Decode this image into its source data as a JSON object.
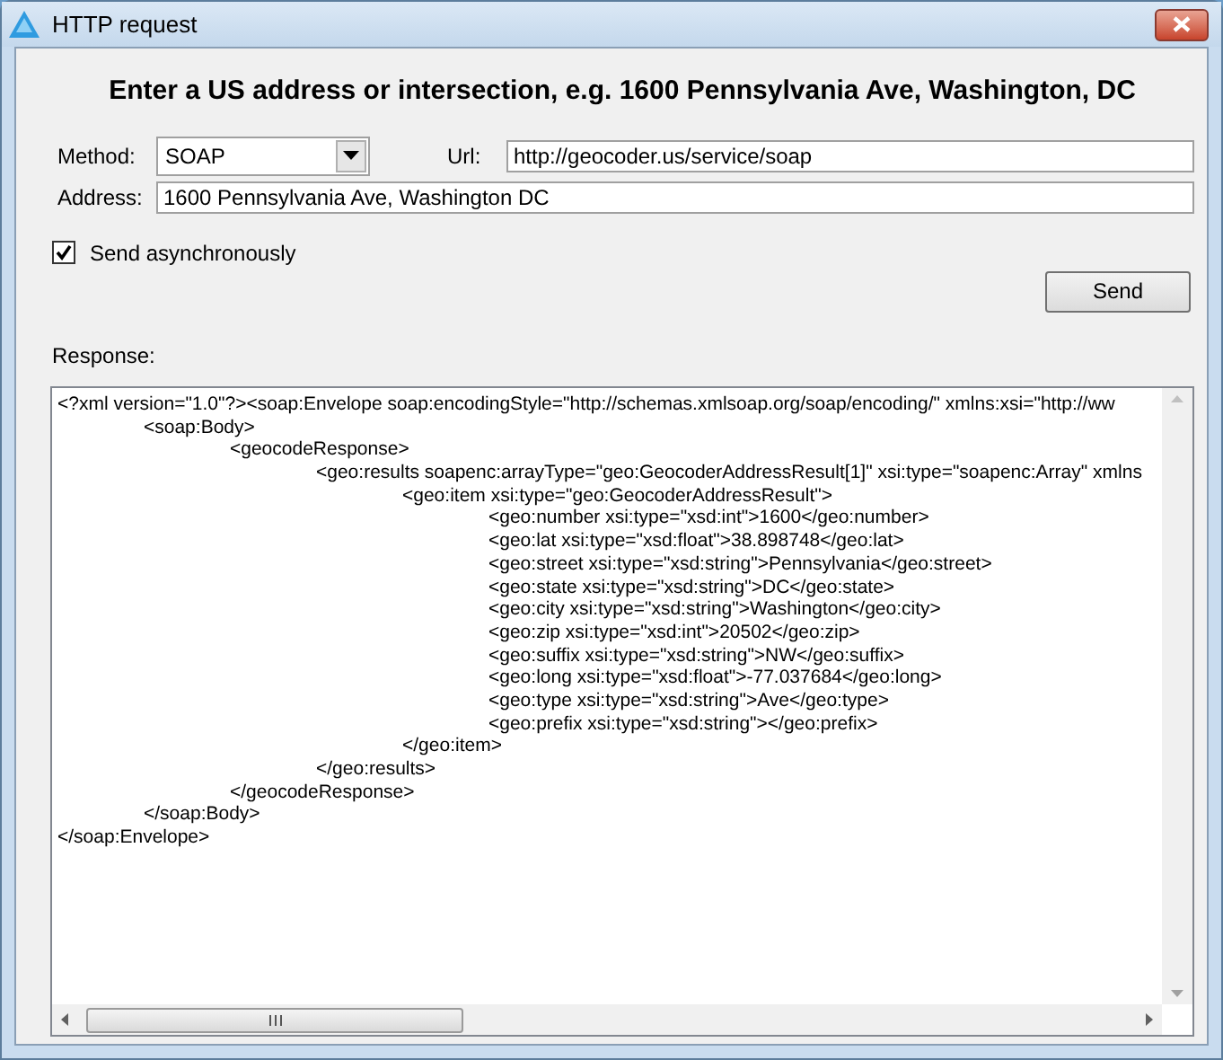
{
  "window": {
    "title": "HTTP request"
  },
  "heading": "Enter a US address or intersection, e.g. 1600 Pennsylvania Ave, Washington, DC",
  "method": {
    "label": "Method:",
    "value": "SOAP"
  },
  "url": {
    "label": "Url:",
    "value": "http://geocoder.us/service/soap"
  },
  "address": {
    "label": "Address:",
    "value": "1600 Pennsylvania Ave, Washington DC"
  },
  "async": {
    "label": "Send asynchronously",
    "checked": true
  },
  "send_button": "Send",
  "response": {
    "label": "Response:",
    "lines": [
      {
        "line": "<?xml version=\"1.0\"?><soap:Envelope soap:encodingStyle=\"http://schemas.xmlsoap.org/soap/encoding/\" xmlns:xsi=\"http://ww",
        "end": "</soap:Envelope>",
        "children": [
          {
            "line": "<soap:Body>",
            "end": "</soap:Body>",
            "children": [
              {
                "line": "<geocodeResponse>",
                "end": "</geocodeResponse>",
                "children": [
                  {
                    "line": "<geo:results soapenc:arrayType=\"geo:GeocoderAddressResult[1]\" xsi:type=\"soapenc:Array\" xmlns",
                    "end": "</geo:results>",
                    "children": [
                      {
                        "line": "<geo:item xsi:type=\"geo:GeocoderAddressResult\">",
                        "end": "</geo:item>",
                        "children": [
                          {
                            "line": "<geo:number xsi:type=\"xsd:int\">1600</geo:number>"
                          },
                          {
                            "line": "<geo:lat xsi:type=\"xsd:float\">38.898748</geo:lat>"
                          },
                          {
                            "line": "<geo:street xsi:type=\"xsd:string\">Pennsylvania</geo:street>"
                          },
                          {
                            "line": "<geo:state xsi:type=\"xsd:string\">DC</geo:state>"
                          },
                          {
                            "line": "<geo:city xsi:type=\"xsd:string\">Washington</geo:city>"
                          },
                          {
                            "line": "<geo:zip xsi:type=\"xsd:int\">20502</geo:zip>"
                          },
                          {
                            "line": "<geo:suffix xsi:type=\"xsd:string\">NW</geo:suffix>"
                          },
                          {
                            "line": "<geo:long xsi:type=\"xsd:float\">-77.037684</geo:long>"
                          },
                          {
                            "line": "<geo:type xsi:type=\"xsd:string\">Ave</geo:type>"
                          },
                          {
                            "line": "<geo:prefix xsi:type=\"xsd:string\"></geo:prefix>"
                          }
                        ]
                      }
                    ]
                  }
                ]
              }
            ]
          }
        ]
      }
    ]
  }
}
